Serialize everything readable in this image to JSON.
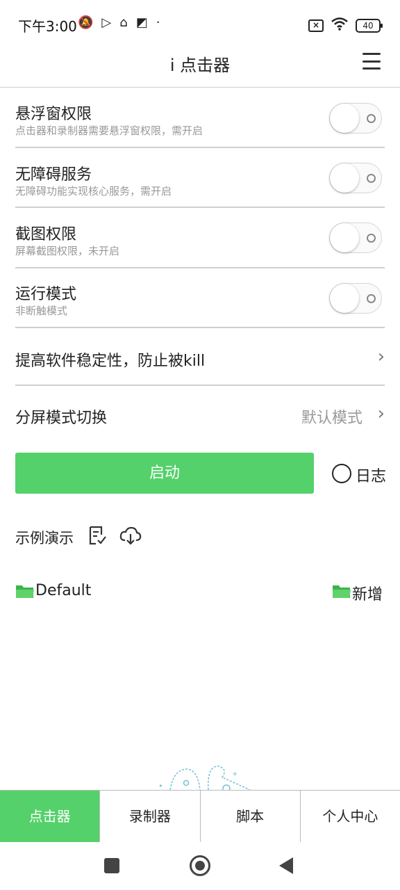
{
  "status_bar": {
    "time": "下午3:00",
    "battery": "40"
  },
  "app_bar": {
    "title": "i 点击器"
  },
  "settings": [
    {
      "title": "悬浮窗权限",
      "subtitle": "点击器和录制器需要悬浮窗权限，需开启",
      "enabled": false
    },
    {
      "title": "无障碍服务",
      "subtitle": "无障碍功能实现核心服务，需开启",
      "enabled": false
    },
    {
      "title": "截图权限",
      "subtitle": "屏幕截图权限，未开启",
      "enabled": false
    },
    {
      "title": "运行模式",
      "subtitle": "非断触模式",
      "enabled": false
    }
  ],
  "links": {
    "stability": "提高软件稳定性，防止被kill",
    "split_screen": "分屏模式切换",
    "split_screen_value": "默认模式"
  },
  "actions": {
    "start_label": "启动",
    "log_label": "日志"
  },
  "demo": {
    "label": "示例演示"
  },
  "folders": {
    "default_label": "Default",
    "add_label": "新增"
  },
  "tabs": [
    {
      "label": "点击器",
      "active": true
    },
    {
      "label": "录制器",
      "active": false
    },
    {
      "label": "脚本",
      "active": false
    },
    {
      "label": "个人中心",
      "active": false
    }
  ],
  "colors": {
    "accent": "#54d16a",
    "divider": "#cfcfcf"
  }
}
